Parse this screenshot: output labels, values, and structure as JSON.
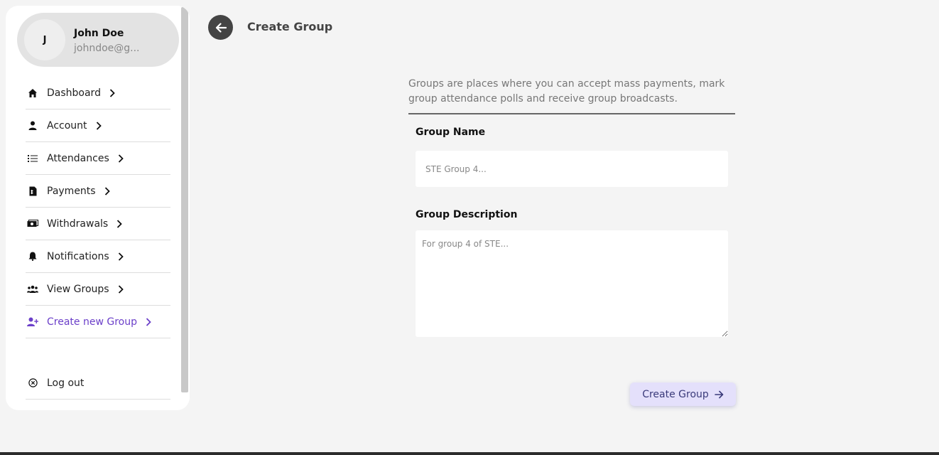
{
  "profile": {
    "initial": "J",
    "name": "John Doe",
    "email": "johndoe@g..."
  },
  "nav": {
    "items": [
      {
        "label": "Dashboard",
        "icon": "home-icon"
      },
      {
        "label": "Account",
        "icon": "user-icon"
      },
      {
        "label": "Attendances",
        "icon": "list-icon"
      },
      {
        "label": "Payments",
        "icon": "receipt-icon"
      },
      {
        "label": "Withdrawals",
        "icon": "cash-icon"
      },
      {
        "label": "Notifications",
        "icon": "bell-icon"
      },
      {
        "label": "View Groups",
        "icon": "users-icon"
      },
      {
        "label": "Create new Group",
        "icon": "user-plus-icon",
        "active": true
      }
    ],
    "logout_label": "Log out"
  },
  "header": {
    "title": "Create Group"
  },
  "form": {
    "intro": "Groups are places where you can accept mass payments, mark group attendance polls and receive group broadcasts.",
    "name_label": "Group Name",
    "name_placeholder": "STE Group 4...",
    "name_value": "",
    "description_label": "Group Description",
    "description_placeholder": "For group 4 of STE...",
    "description_value": "",
    "submit_label": "Create Group"
  },
  "colors": {
    "accent": "#6b3fc9",
    "background": "#f4f4f4",
    "submit_bg": "#e4e0fb"
  }
}
